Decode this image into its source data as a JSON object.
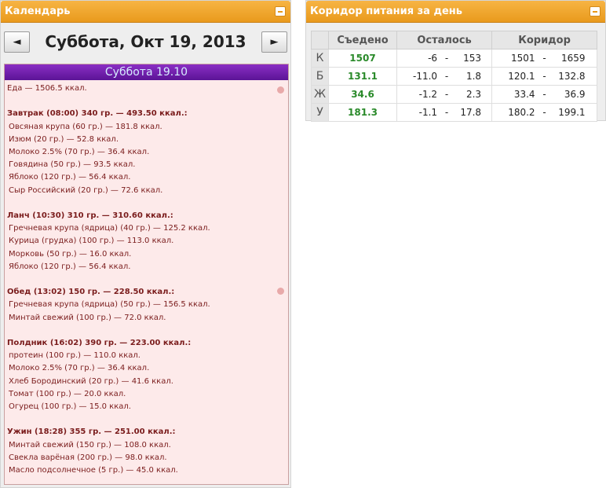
{
  "calendar": {
    "title": "Календарь",
    "date_title": "Суббота, Окт 19, 2013",
    "prev_label": "◄",
    "next_label": "►",
    "day_header": "Суббота 19.10",
    "total": "Еда — 1506.5 ккал.",
    "meals": [
      {
        "title": "Завтрак (08:00) 340 гр. — 493.50 ккал.:",
        "items": [
          "Овсяная крупа (60 гр.) — 181.8 ккал.",
          "Изюм (20 гр.) — 52.8 ккал.",
          "Молоко 2.5% (70 гр.) — 36.4 ккал.",
          "Говядина (50 гр.) — 93.5 ккал.",
          "Яблоко (120 гр.) — 56.4 ккал.",
          "Сыр Российский (20 гр.) — 72.6 ккал."
        ]
      },
      {
        "title": "Ланч (10:30) 310 гр. — 310.60 ккал.:",
        "items": [
          "Гречневая крупа (ядрица) (40 гр.) — 125.2 ккал.",
          "Курица (грудка) (100 гр.) — 113.0 ккал.",
          "Морковь (50 гр.) — 16.0 ккал.",
          "Яблоко (120 гр.) — 56.4 ккал."
        ]
      },
      {
        "title": "Обед (13:02) 150 гр. — 228.50 ккал.:",
        "items": [
          "Гречневая крупа (ядрица) (50 гр.) — 156.5 ккал.",
          "Минтай свежий (100 гр.) — 72.0 ккал."
        ]
      },
      {
        "title": "Полдник (16:02) 390 гр. — 223.00 ккал.:",
        "items": [
          "протеин (100 гр.) — 110.0 ккал.",
          "Молоко 2.5% (70 гр.) — 36.4 ккал.",
          "Хлеб Бородинский (20 гр.) — 41.6 ккал.",
          "Томат (100 гр.) — 20.0 ккал.",
          "Огурец (100 гр.) — 15.0 ккал."
        ]
      },
      {
        "title": "Ужин (18:28) 355 гр. — 251.00 ккал.:",
        "items": [
          "Минтай свежий (150 гр.) — 108.0 ккал.",
          "Свекла варёная (200 гр.) — 98.0 ккал.",
          "Масло подсолнечное (5 гр.) — 45.0 ккал."
        ]
      }
    ]
  },
  "corridor": {
    "title": "Коридор питания за день",
    "headers": [
      "Съедено",
      "Осталось",
      "Коридор"
    ],
    "rows": [
      {
        "label": "К",
        "eaten": "1507",
        "left_min": "-6",
        "left_max": "153",
        "corr_min": "1501",
        "corr_max": "1659"
      },
      {
        "label": "Б",
        "eaten": "131.1",
        "left_min": "-11.0",
        "left_max": "1.8",
        "corr_min": "120.1",
        "corr_max": "132.8"
      },
      {
        "label": "Ж",
        "eaten": "34.6",
        "left_min": "-1.2",
        "left_max": "2.3",
        "corr_min": "33.4",
        "corr_max": "36.9"
      },
      {
        "label": "У",
        "eaten": "181.3",
        "left_min": "-1.1",
        "left_max": "17.8",
        "corr_min": "180.2",
        "corr_max": "199.1"
      }
    ],
    "dash": "-"
  },
  "colors": {
    "header_orange": "#e99a1c",
    "day_header_purple": "#6a1aa8",
    "eaten_green": "#2a8a2a",
    "meal_text": "#7a1c1c"
  }
}
